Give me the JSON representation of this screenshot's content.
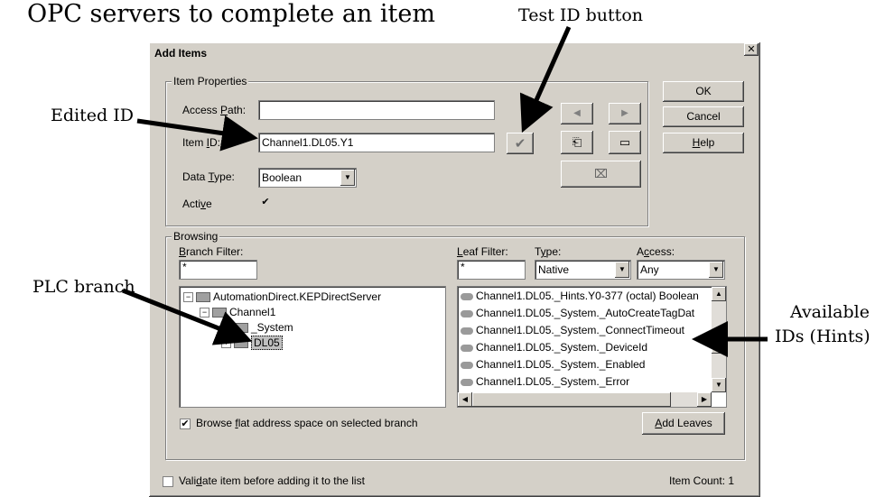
{
  "callouts": {
    "top": "OPC servers to complete an item",
    "test_id": "Test ID button",
    "edited_id": "Edited ID",
    "plc_branch": "PLC branch",
    "available_line1": "Available",
    "available_line2": "IDs (Hints)"
  },
  "dialog": {
    "title": "Add Items",
    "close_glyph": "✕",
    "item_properties": {
      "group_label": "Item Properties",
      "access_path_label": "Access Path:",
      "access_path_value": "",
      "item_id_label": "Item ID:",
      "item_id_value": "Channel1.DL05.Y1",
      "data_type_label": "Data Type:",
      "data_type_value": "Boolean",
      "active_label": "Active",
      "active_checked": "✔"
    },
    "buttons": {
      "ok": "OK",
      "cancel": "Cancel",
      "help": "Help",
      "add_leaves": "Add Leaves"
    },
    "browsing": {
      "group_label": "Browsing",
      "branch_filter_label": "Branch Filter:",
      "branch_filter_value": "*",
      "leaf_filter_label": "Leaf Filter:",
      "leaf_filter_value": "*",
      "type_label": "Type:",
      "type_value": "Native",
      "access_label": "Access:",
      "access_value": "Any",
      "tree": [
        {
          "label": "AutomationDirect.KEPDirectServer",
          "toggle": "−"
        },
        {
          "label": "Channel1",
          "toggle": "−"
        },
        {
          "label": "_System",
          "toggle": "+"
        },
        {
          "label": "DL05",
          "toggle": "+"
        }
      ],
      "leaves": [
        "Channel1.DL05._Hints.Y0-377 (octal) Boolean",
        "Channel1.DL05._System._AutoCreateTagDat",
        "Channel1.DL05._System._ConnectTimeout",
        "Channel1.DL05._System._DeviceId",
        "Channel1.DL05._System._Enabled",
        "Channel1.DL05._System._Error"
      ],
      "flat_label": "Browse flat address space on selected branch",
      "flat_checked": "✔"
    },
    "footer": {
      "validate_label": "Validate item before adding it to the list",
      "validate_checked": "",
      "item_count": "Item Count: 1"
    }
  }
}
